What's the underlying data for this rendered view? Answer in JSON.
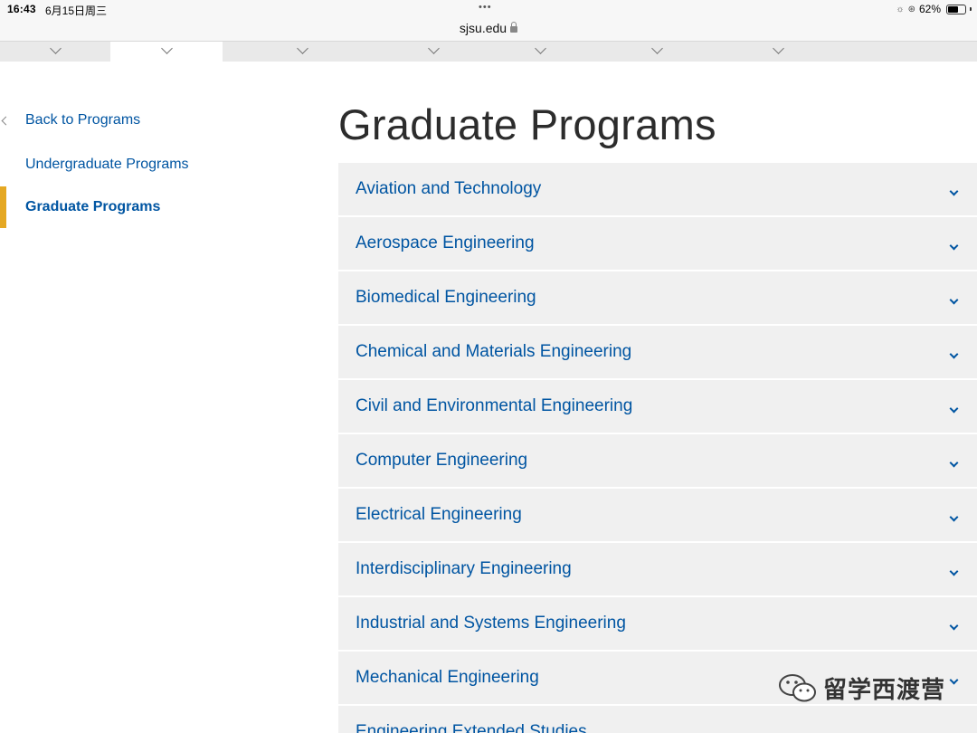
{
  "status_bar": {
    "time": "16:43",
    "date": "6月15日周三",
    "dots": "•••",
    "battery_percent": "62%",
    "battery_level": 0.62
  },
  "browser": {
    "url": "sjsu.edu"
  },
  "sidebar": {
    "back_label": "Back to Programs",
    "items": [
      {
        "label": "Undergraduate Programs",
        "active": false
      },
      {
        "label": "Graduate Programs",
        "active": true
      }
    ]
  },
  "main": {
    "title": "Graduate Programs",
    "programs": [
      "Aviation and Technology",
      "Aerospace Engineering",
      "Biomedical Engineering",
      "Chemical and Materials Engineering",
      "Civil and Environmental Engineering",
      "Computer Engineering",
      "Electrical Engineering",
      "Interdisciplinary Engineering",
      "Industrial and Systems Engineering",
      "Mechanical Engineering",
      "Engineering Extended Studies"
    ]
  },
  "watermark": {
    "text": "留学西渡营"
  },
  "colors": {
    "link": "#0055a2",
    "accent": "#e5a823",
    "panel": "#f0f0f0"
  }
}
